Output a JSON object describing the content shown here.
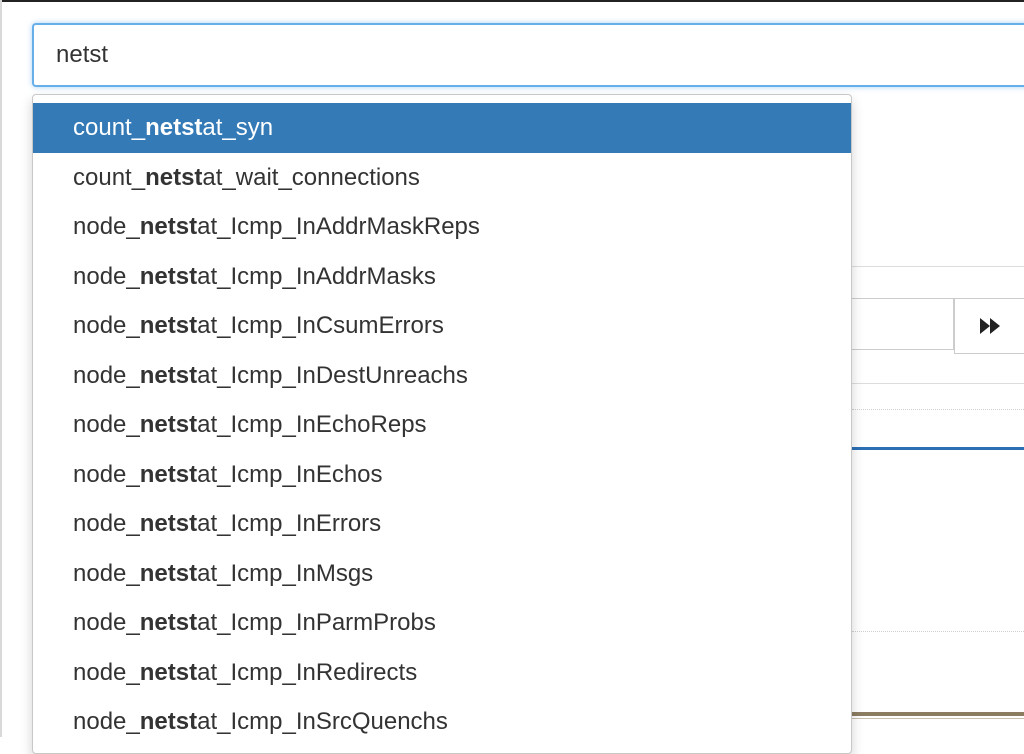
{
  "search": {
    "value": "netst",
    "match": "netst"
  },
  "suggestions": [
    {
      "before": "count_",
      "after": "at_syn",
      "active": true
    },
    {
      "before": "count_",
      "after": "at_wait_connections",
      "active": false
    },
    {
      "before": "node_",
      "after": "at_Icmp_InAddrMaskReps",
      "active": false
    },
    {
      "before": "node_",
      "after": "at_Icmp_InAddrMasks",
      "active": false
    },
    {
      "before": "node_",
      "after": "at_Icmp_InCsumErrors",
      "active": false
    },
    {
      "before": "node_",
      "after": "at_Icmp_InDestUnreachs",
      "active": false
    },
    {
      "before": "node_",
      "after": "at_Icmp_InEchoReps",
      "active": false
    },
    {
      "before": "node_",
      "after": "at_Icmp_InEchos",
      "active": false
    },
    {
      "before": "node_",
      "after": "at_Icmp_InErrors",
      "active": false
    },
    {
      "before": "node_",
      "after": "at_Icmp_InMsgs",
      "active": false
    },
    {
      "before": "node_",
      "after": "at_Icmp_InParmProbs",
      "active": false
    },
    {
      "before": "node_",
      "after": "at_Icmp_InRedirects",
      "active": false
    },
    {
      "before": "node_",
      "after": "at_Icmp_InSrcQuenchs",
      "active": false
    }
  ],
  "colors": {
    "active_bg": "#337ab7",
    "focus_border": "#66afe9"
  },
  "icons": {
    "next": "fast-forward-icon"
  }
}
